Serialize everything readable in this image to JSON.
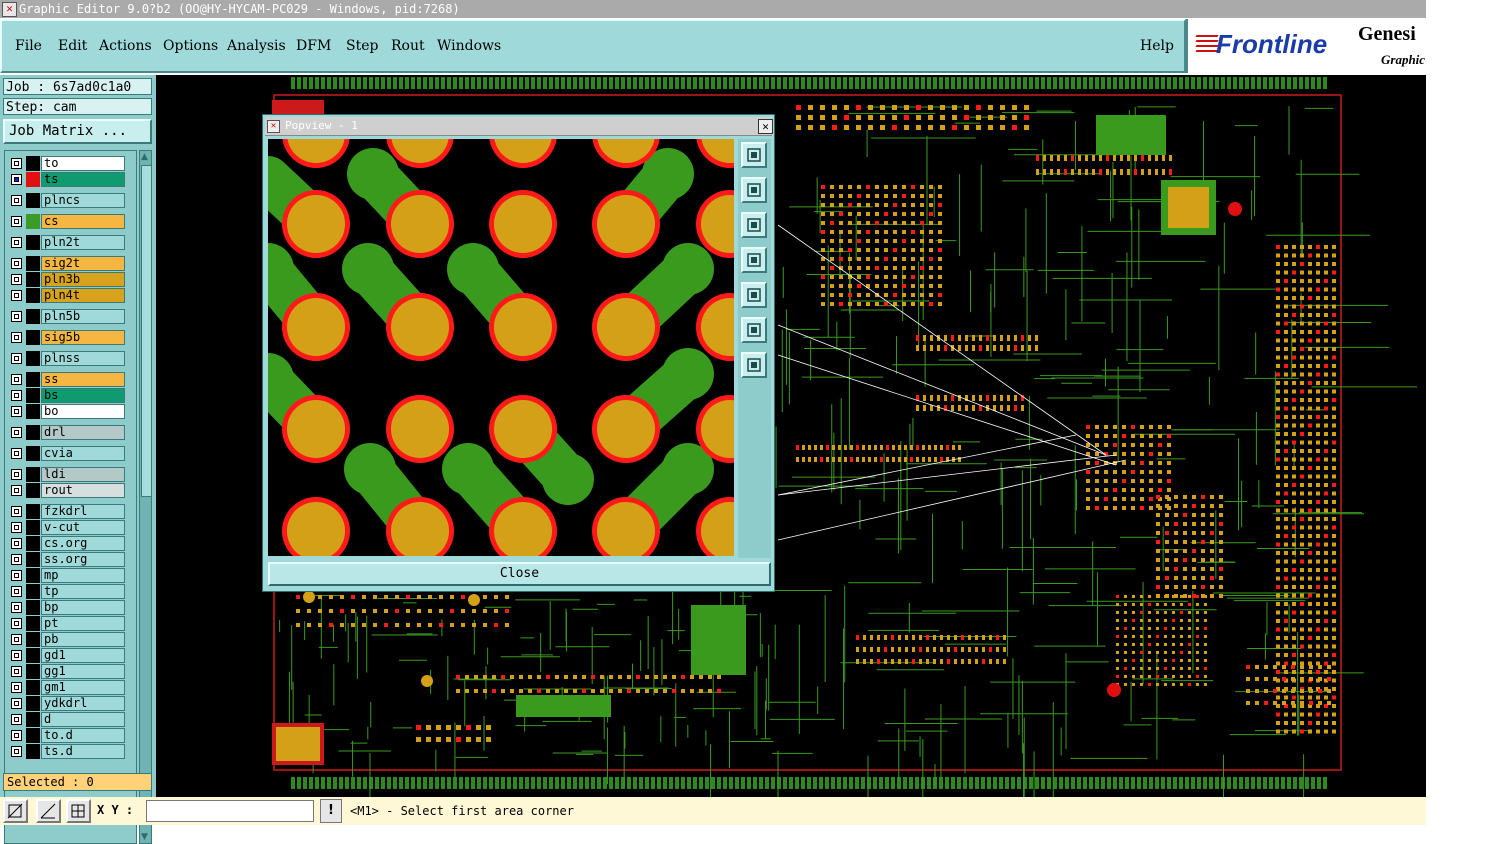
{
  "window": {
    "title": "Graphic Editor 9.0?b2 (OO@HY-HYCAM-PC029 - Windows, pid:7268)"
  },
  "menu": {
    "items": [
      "File",
      "Edit",
      "Actions",
      "Options",
      "Analysis",
      "DFM",
      "Step",
      "Rout",
      "Windows"
    ],
    "help": "Help"
  },
  "logo": {
    "brand": "Frontline",
    "product": "Genesi",
    "subtitle": "Graphic"
  },
  "left_panel": {
    "job": "Job : 6s7ad0c1a0",
    "step": "Step: cam",
    "job_matrix_button": "Job Matrix ...",
    "selected": "Selected : 0"
  },
  "layers": [
    {
      "name": "to",
      "fill": "#ffffff",
      "color": "#000000"
    },
    {
      "name": "ts",
      "fill": "#0f9a6f",
      "color": "#e01010",
      "active": true
    },
    {
      "name": "plncs",
      "fill": "#9fd9d9",
      "color": "#000000"
    },
    {
      "name": "cs",
      "fill": "#f5b642",
      "color": "#3a9a2a"
    },
    {
      "name": "pln2t",
      "fill": "#9fd9d9",
      "color": "#000000"
    },
    {
      "name": "sig2t",
      "fill": "#f5b642",
      "color": "#000000"
    },
    {
      "name": "pln3b",
      "fill": "#d9a21c",
      "color": "#000000"
    },
    {
      "name": "pln4t",
      "fill": "#d9a21c",
      "color": "#000000"
    },
    {
      "name": "pln5b",
      "fill": "#9fd9d9",
      "color": "#000000"
    },
    {
      "name": "sig5b",
      "fill": "#f5b642",
      "color": "#000000"
    },
    {
      "name": "plnss",
      "fill": "#9fd9d9",
      "color": "#000000"
    },
    {
      "name": "ss",
      "fill": "#f5b642",
      "color": "#000000"
    },
    {
      "name": "bs",
      "fill": "#0f9a6f",
      "color": "#000000"
    },
    {
      "name": "bo",
      "fill": "#ffffff",
      "color": "#000000"
    },
    {
      "name": "drl",
      "fill": "#b4c8c8",
      "color": "#000000"
    },
    {
      "name": "cvia",
      "fill": "#9fd9d9",
      "color": "#000000"
    },
    {
      "name": "ldi",
      "fill": "#b4c8c8",
      "color": "#000000"
    },
    {
      "name": "rout",
      "fill": "#d6dede",
      "color": "#000000"
    },
    {
      "name": "fzkdrl",
      "fill": "#9fd9d9",
      "color": "#000000"
    },
    {
      "name": "v-cut",
      "fill": "#9fd9d9",
      "color": "#000000"
    },
    {
      "name": "cs.org",
      "fill": "#9fd9d9",
      "color": "#000000"
    },
    {
      "name": "ss.org",
      "fill": "#9fd9d9",
      "color": "#000000"
    },
    {
      "name": "mp",
      "fill": "#9fd9d9",
      "color": "#000000"
    },
    {
      "name": "tp",
      "fill": "#9fd9d9",
      "color": "#000000"
    },
    {
      "name": "bp",
      "fill": "#9fd9d9",
      "color": "#000000"
    },
    {
      "name": "pt",
      "fill": "#9fd9d9",
      "color": "#000000"
    },
    {
      "name": "pb",
      "fill": "#9fd9d9",
      "color": "#000000"
    },
    {
      "name": "gd1",
      "fill": "#9fd9d9",
      "color": "#000000"
    },
    {
      "name": "gg1",
      "fill": "#9fd9d9",
      "color": "#000000"
    },
    {
      "name": "gm1",
      "fill": "#9fd9d9",
      "color": "#000000"
    },
    {
      "name": "ydkdrl",
      "fill": "#9fd9d9",
      "color": "#000000"
    },
    {
      "name": "d",
      "fill": "#9fd9d9",
      "color": "#000000"
    },
    {
      "name": "to.d",
      "fill": "#9fd9d9",
      "color": "#000000"
    },
    {
      "name": "ts.d",
      "fill": "#9fd9d9",
      "color": "#000000"
    }
  ],
  "popview": {
    "title": "Popview - 1",
    "close_button": "Close",
    "tools": [
      "zoom-window-icon",
      "pan-up-icon",
      "pan-down-icon",
      "pan-left-icon",
      "pan-right-icon",
      "zoom-fit-icon",
      "center-icon"
    ]
  },
  "status_bar": {
    "xy_label": "X Y :",
    "xy_value": "",
    "alert_button": "!",
    "prompt": "<M1> - Select first area corner",
    "tools": [
      "zoom-area-icon",
      "measure-icon",
      "grid-icon"
    ]
  },
  "colors": {
    "panel": "#9fd9d9",
    "pad_fill": "#d4a017",
    "pad_ring": "#ff1a1a",
    "trace": "#3a9a1e",
    "board_bg": "#000000"
  }
}
